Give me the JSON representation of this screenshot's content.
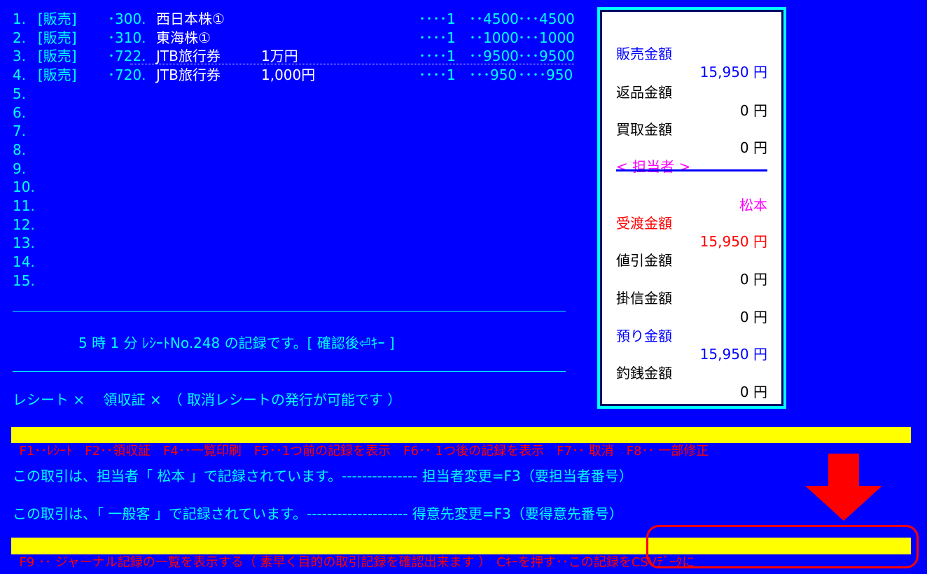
{
  "lines": [
    {
      "no": "1.",
      "cat": "[販売]",
      "code": "･300.",
      "name": "西日本株①",
      "name2": "",
      "qty": "････1",
      "price": "･･4500",
      "total": "･･･4500"
    },
    {
      "no": "2.",
      "cat": "[販売]",
      "code": "･310.",
      "name": "東海株①",
      "name2": "",
      "qty": "････1",
      "price": "･･1000",
      "total": "･･･1000"
    },
    {
      "no": "3.",
      "cat": "[販売]",
      "code": "･722.",
      "name": "JTB旅行券",
      "name2": "1万円",
      "qty": "････1",
      "price": "･･9500",
      "total": "･･･9500"
    },
    {
      "no": "4.",
      "cat": "[販売]",
      "code": "･720.",
      "name": "JTB旅行券",
      "name2": "1,000円",
      "qty": "････1",
      "price": "･･･950",
      "total": "････950"
    },
    {
      "no": "5.",
      "cat": "",
      "code": "",
      "name": "",
      "name2": "",
      "qty": "",
      "price": "",
      "total": ""
    },
    {
      "no": "6.",
      "cat": "",
      "code": "",
      "name": "",
      "name2": "",
      "qty": "",
      "price": "",
      "total": ""
    },
    {
      "no": "7.",
      "cat": "",
      "code": "",
      "name": "",
      "name2": "",
      "qty": "",
      "price": "",
      "total": ""
    },
    {
      "no": "8.",
      "cat": "",
      "code": "",
      "name": "",
      "name2": "",
      "qty": "",
      "price": "",
      "total": ""
    },
    {
      "no": "9.",
      "cat": "",
      "code": "",
      "name": "",
      "name2": "",
      "qty": "",
      "price": "",
      "total": ""
    },
    {
      "no": "10.",
      "cat": "",
      "code": "",
      "name": "",
      "name2": "",
      "qty": "",
      "price": "",
      "total": ""
    },
    {
      "no": "11.",
      "cat": "",
      "code": "",
      "name": "",
      "name2": "",
      "qty": "",
      "price": "",
      "total": ""
    },
    {
      "no": "12.",
      "cat": "",
      "code": "",
      "name": "",
      "name2": "",
      "qty": "",
      "price": "",
      "total": ""
    },
    {
      "no": "13.",
      "cat": "",
      "code": "",
      "name": "",
      "name2": "",
      "qty": "",
      "price": "",
      "total": ""
    },
    {
      "no": "14.",
      "cat": "",
      "code": "",
      "name": "",
      "name2": "",
      "qty": "",
      "price": "",
      "total": ""
    },
    {
      "no": "15.",
      "cat": "",
      "code": "",
      "name": "",
      "name2": "",
      "qty": "",
      "price": "",
      "total": ""
    }
  ],
  "record_message": "5 時 1 分 ﾚｼｰﾄNo.248 の記録です。[ 確認後⏎ｷｰ ]",
  "receipt_status": "レシート ×　 領収証 ×　（ 取消レシートの発行が可能です ）",
  "panel": {
    "sales_label": "販売金額",
    "sales_value": "15,950 円",
    "returns_label": "返品金額",
    "returns_value": "0 円",
    "purchase_label": "買取金額",
    "purchase_value": "0 円",
    "staff_label": "< 担当者 >",
    "staff_name": "松本",
    "received_label": "受渡金額",
    "received_value": "15,950 円",
    "discount_label": "値引金額",
    "discount_value": "0 円",
    "credit_label": "掛信金額",
    "credit_value": "0 円",
    "deposit_label": "預り金額",
    "deposit_value": "15,950 円",
    "change_label": "釣銭金額",
    "change_value": "0 円"
  },
  "fkeys": [
    "F1･･ﾚｼｰﾄ",
    "F2･･領収証",
    "F4･･一覧印刷",
    "F5･･1つ前の記録を表示",
    "F6･･ 1つ後の記録を表示",
    "F7･･ 取消",
    "F8･･ 一部修正"
  ],
  "info_staff": "この取引は、担当者「 松本 」で記録されています。--------------- 担当者変更=F3（要担当者番号）",
  "info_customer": "この取引は、「 一般客 」で記録されています。-------------------- 得意先変更=F3（要得意先番号）",
  "f9_text": "F9 ･･ ジャーナル記録の一覧を表示する（ 素早く目的の取引記録を確認出来ます ）",
  "csv_text": "Cｷｰを押す･･この記録をCSVﾃﾞｰﾀに",
  "colors": {
    "background": "#0000ff",
    "text": "#00ffff",
    "highlight": "#ffff00",
    "alert": "#ff0000"
  }
}
